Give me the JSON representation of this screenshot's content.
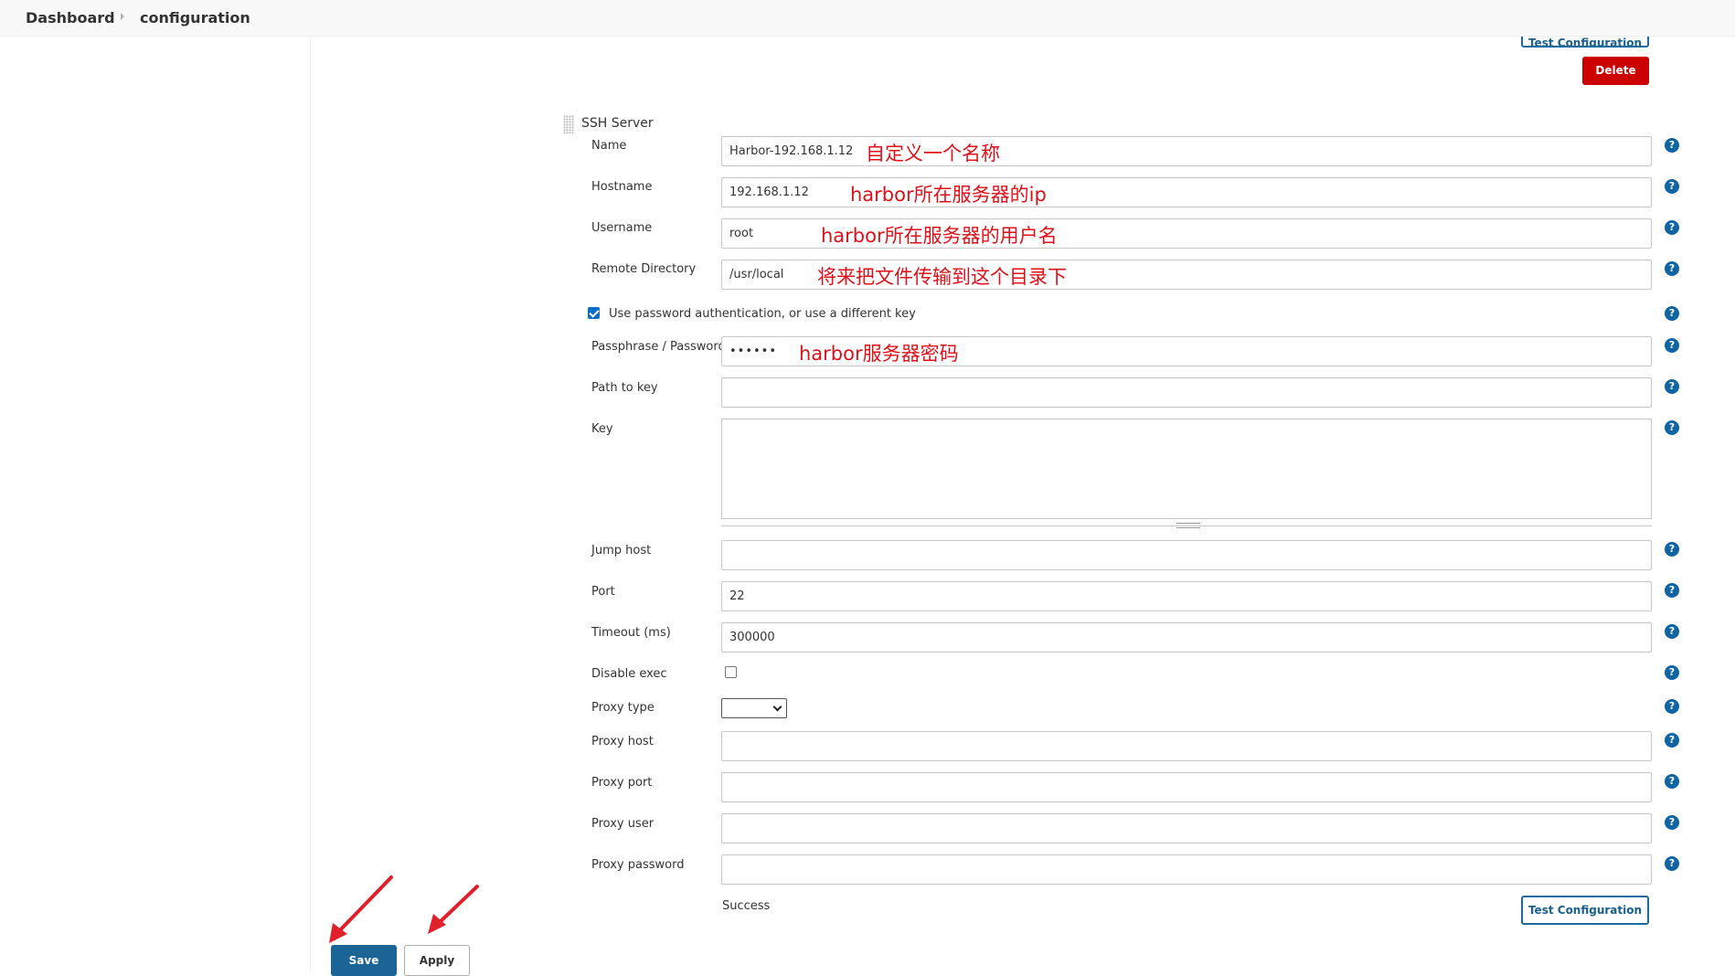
{
  "breadcrumb": {
    "dashboard": "Dashboard",
    "configuration": "configuration"
  },
  "top_test_button": "Test Configuration",
  "delete_button": "Delete",
  "section": {
    "title": "SSH Server"
  },
  "fields": {
    "name": {
      "label": "Name",
      "value": "Harbor-192.168.1.12",
      "annotation": "自定义一个名称"
    },
    "hostname": {
      "label": "Hostname",
      "value": "192.168.1.12",
      "annotation": "harbor所在服务器的ip"
    },
    "username": {
      "label": "Username",
      "value": "root",
      "annotation": "harbor所在服务器的用户名"
    },
    "remote_directory": {
      "label": "Remote Directory",
      "value": "/usr/local",
      "annotation": "将来把文件传输到这个目录下"
    },
    "use_password": {
      "label": "Use password authentication, or use a different key",
      "checked": true
    },
    "password": {
      "label": "Passphrase / Password",
      "value": "••••••",
      "annotation": "harbor服务器密码"
    },
    "path_to_key": {
      "label": "Path to key",
      "value": ""
    },
    "key": {
      "label": "Key",
      "value": ""
    },
    "jump_host": {
      "label": "Jump host",
      "value": ""
    },
    "port": {
      "label": "Port",
      "value": "22"
    },
    "timeout": {
      "label": "Timeout (ms)",
      "value": "300000"
    },
    "disable_exec": {
      "label": "Disable exec",
      "checked": false
    },
    "proxy_type": {
      "label": "Proxy type",
      "selected": ""
    },
    "proxy_host": {
      "label": "Proxy host",
      "value": ""
    },
    "proxy_port": {
      "label": "Proxy port",
      "value": ""
    },
    "proxy_user": {
      "label": "Proxy user",
      "value": ""
    },
    "proxy_password": {
      "label": "Proxy password",
      "value": ""
    }
  },
  "status": {
    "text": "Success"
  },
  "test_button": "Test Configuration",
  "help_glyph": "?",
  "buttons": {
    "save": "Save",
    "apply": "Apply"
  },
  "colors": {
    "primary": "#1a6496",
    "danger": "#cc0000",
    "annotation": "#e0101a",
    "help": "#0e64a4"
  },
  "icons": {
    "help": "help-icon",
    "drag": "drag-handle-icon",
    "arrow": "red-arrow-icon"
  }
}
